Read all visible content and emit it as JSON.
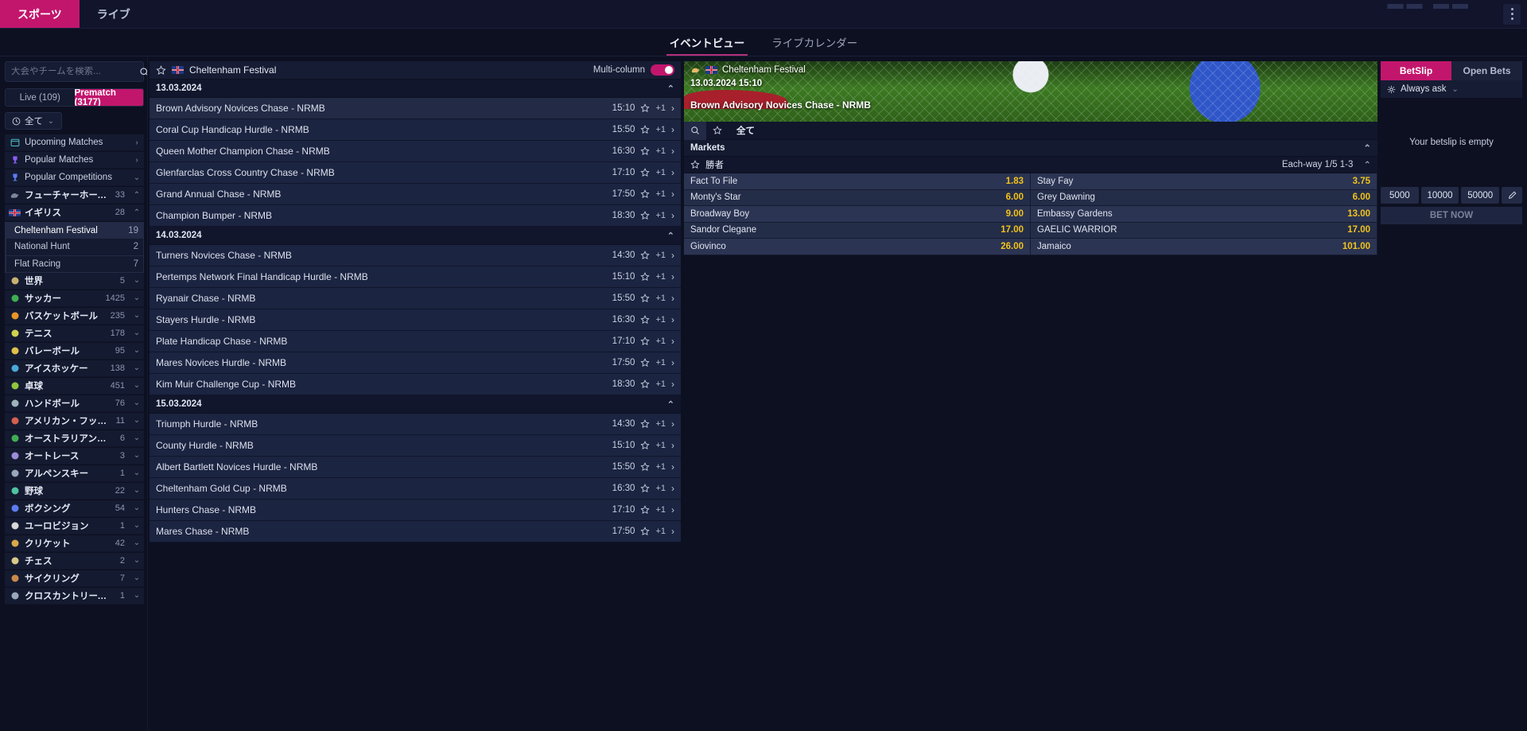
{
  "topbar": {
    "tabs": [
      {
        "label": "スポーツ",
        "active": true
      },
      {
        "label": "ライブ",
        "active": false
      }
    ],
    "menu_icon": "kebab-menu-icon"
  },
  "subnav": {
    "tabs": [
      {
        "label": "イベントビュー",
        "active": true
      },
      {
        "label": "ライブカレンダー",
        "active": false
      }
    ]
  },
  "sidebar": {
    "search": {
      "placeholder": "大会やチームを検索...",
      "value": "",
      "icon": "search-icon"
    },
    "segments": [
      {
        "label": "Live (109)",
        "active": false
      },
      {
        "label": "Prematch (3177)",
        "active": true
      }
    ],
    "time_filter": {
      "label": "全て",
      "icon": "clock-icon",
      "chevron": "⌄"
    },
    "nav_items": [
      {
        "label": "Upcoming Matches",
        "icon": "calendar-icon",
        "count": "",
        "chevron": "›"
      },
      {
        "label": "Popular Matches",
        "icon": "trophy-icon",
        "count": "",
        "chevron": "›"
      },
      {
        "label": "Popular Competitions",
        "icon": "trophy-icon",
        "count": "",
        "chevron": "⌄"
      }
    ],
    "groups": [
      {
        "label": "フューチャーホース...",
        "icon": "horse-racing-icon",
        "count": "33",
        "chevron": "⌃",
        "expanded": false,
        "children": []
      },
      {
        "label": "イギリス",
        "icon": "uk-flag-icon",
        "count": "28",
        "chevron": "⌃",
        "expanded": true,
        "children": [
          {
            "label": "Cheltenham Festival",
            "count": "19",
            "active": true
          },
          {
            "label": "National Hunt",
            "count": "2",
            "active": false
          },
          {
            "label": "Flat Racing",
            "count": "7",
            "active": false
          }
        ]
      }
    ],
    "sports": [
      {
        "label": "世界",
        "icon": "globe-icon",
        "count": "5",
        "chevron": "⌄"
      },
      {
        "label": "サッカー",
        "icon": "soccer-icon",
        "count": "1425",
        "chevron": "⌄"
      },
      {
        "label": "バスケットボール",
        "icon": "basketball-icon",
        "count": "235",
        "chevron": "⌄"
      },
      {
        "label": "テニス",
        "icon": "tennis-icon",
        "count": "178",
        "chevron": "⌄"
      },
      {
        "label": "バレーボール",
        "icon": "volleyball-icon",
        "count": "95",
        "chevron": "⌄"
      },
      {
        "label": "アイスホッケー",
        "icon": "ice-hockey-icon",
        "count": "138",
        "chevron": "⌄"
      },
      {
        "label": "卓球",
        "icon": "table-tennis-icon",
        "count": "451",
        "chevron": "⌄"
      },
      {
        "label": "ハンドボール",
        "icon": "handball-icon",
        "count": "76",
        "chevron": "⌄"
      },
      {
        "label": "アメリカン・フット...",
        "icon": "american-football-icon",
        "count": "11",
        "chevron": "⌄"
      },
      {
        "label": "オーストラリアン・…",
        "icon": "aussie-rules-icon",
        "count": "6",
        "chevron": "⌄"
      },
      {
        "label": "オートレース",
        "icon": "motor-racing-icon",
        "count": "3",
        "chevron": "⌄"
      },
      {
        "label": "アルペンスキー",
        "icon": "alpine-skiing-icon",
        "count": "1",
        "chevron": "⌄"
      },
      {
        "label": "野球",
        "icon": "baseball-icon",
        "count": "22",
        "chevron": "⌄"
      },
      {
        "label": "ボクシング",
        "icon": "boxing-icon",
        "count": "54",
        "chevron": "⌄"
      },
      {
        "label": "ユーロビジョン",
        "icon": "eurovision-icon",
        "count": "1",
        "chevron": "⌄"
      },
      {
        "label": "クリケット",
        "icon": "cricket-icon",
        "count": "42",
        "chevron": "⌄"
      },
      {
        "label": "チェス",
        "icon": "chess-icon",
        "count": "2",
        "chevron": "⌄"
      },
      {
        "label": "サイクリング",
        "icon": "cycling-icon",
        "count": "7",
        "chevron": "⌄"
      },
      {
        "label": "クロスカントリースキ...",
        "icon": "cross-country-skiing-icon",
        "count": "1",
        "chevron": "⌄"
      }
    ]
  },
  "events": {
    "header": {
      "title": "Cheltenham Festival",
      "star_icon": "star-icon",
      "flag": "uk-flag-icon",
      "multicolumn_label": "Multi-column",
      "multicolumn_on": true
    },
    "days": [
      {
        "date": "13.03.2024",
        "collapse_icon": "⌃",
        "rows": [
          {
            "name": "Brown Advisory Novices Chase - NRMB",
            "time": "15:10",
            "extra": "+1",
            "selected": true
          },
          {
            "name": "Coral Cup Handicap Hurdle - NRMB",
            "time": "15:50",
            "extra": "+1",
            "selected": false
          },
          {
            "name": "Queen Mother Champion Chase - NRMB",
            "time": "16:30",
            "extra": "+1",
            "selected": false
          },
          {
            "name": "Glenfarclas Cross Country Chase - NRMB",
            "time": "17:10",
            "extra": "+1",
            "selected": false
          },
          {
            "name": "Grand Annual Chase - NRMB",
            "time": "17:50",
            "extra": "+1",
            "selected": false
          },
          {
            "name": "Champion Bumper - NRMB",
            "time": "18:30",
            "extra": "+1",
            "selected": false
          }
        ]
      },
      {
        "date": "14.03.2024",
        "collapse_icon": "⌃",
        "rows": [
          {
            "name": "Turners Novices Chase - NRMB",
            "time": "14:30",
            "extra": "+1",
            "selected": false
          },
          {
            "name": "Pertemps Network Final Handicap Hurdle - NRMB",
            "time": "15:10",
            "extra": "+1",
            "selected": false
          },
          {
            "name": "Ryanair Chase - NRMB",
            "time": "15:50",
            "extra": "+1",
            "selected": false
          },
          {
            "name": "Stayers Hurdle - NRMB",
            "time": "16:30",
            "extra": "+1",
            "selected": false
          },
          {
            "name": "Plate Handicap Chase - NRMB",
            "time": "17:10",
            "extra": "+1",
            "selected": false
          },
          {
            "name": "Mares Novices Hurdle - NRMB",
            "time": "17:50",
            "extra": "+1",
            "selected": false
          },
          {
            "name": "Kim Muir Challenge Cup - NRMB",
            "time": "18:30",
            "extra": "+1",
            "selected": false
          }
        ]
      },
      {
        "date": "15.03.2024",
        "collapse_icon": "⌃",
        "rows": [
          {
            "name": "Triumph Hurdle - NRMB",
            "time": "14:30",
            "extra": "+1",
            "selected": false
          },
          {
            "name": "County Hurdle - NRMB",
            "time": "15:10",
            "extra": "+1",
            "selected": false
          },
          {
            "name": "Albert Bartlett Novices Hurdle - NRMB",
            "time": "15:50",
            "extra": "+1",
            "selected": false
          },
          {
            "name": "Cheltenham Gold Cup - NRMB",
            "time": "16:30",
            "extra": "+1",
            "selected": false
          },
          {
            "name": "Hunters Chase - NRMB",
            "time": "17:10",
            "extra": "+1",
            "selected": false
          },
          {
            "name": "Mares Chase - NRMB",
            "time": "17:50",
            "extra": "+1",
            "selected": false
          }
        ]
      }
    ]
  },
  "market": {
    "hero": {
      "competition": "Cheltenham Festival",
      "datetime": "13.03.2024 15:10",
      "event": "Brown Advisory Novices Chase - NRMB",
      "flag": "uk-flag-icon",
      "sport_icon": "horse-racing-icon"
    },
    "tools": {
      "search_icon": "search-icon",
      "star_icon": "star-icon",
      "all_label": "全て",
      "collapse_icon": "⌃"
    },
    "markets_label": "Markets",
    "market_title": "勝者",
    "each_way": "Each-way 1/5 1-3",
    "collapse_icon": "⌃",
    "star_icon": "star-icon",
    "odds": [
      {
        "name": "Fact To File",
        "value": "1.83"
      },
      {
        "name": "Stay Fay",
        "value": "3.75"
      },
      {
        "name": "Monty's Star",
        "value": "6.00"
      },
      {
        "name": "Grey Dawning",
        "value": "6.00"
      },
      {
        "name": "Broadway Boy",
        "value": "9.00"
      },
      {
        "name": "Embassy Gardens",
        "value": "13.00"
      },
      {
        "name": "Sandor Clegane",
        "value": "17.00"
      },
      {
        "name": "GAELIC WARRIOR",
        "value": "17.00"
      },
      {
        "name": "Giovinco",
        "value": "26.00"
      },
      {
        "name": "Jamaico",
        "value": "101.00"
      }
    ]
  },
  "betslip": {
    "tabs": [
      {
        "label": "BetSlip",
        "active": true
      },
      {
        "label": "Open Bets",
        "active": false
      }
    ],
    "always_ask": {
      "label": "Always ask",
      "icon": "gear-icon",
      "chevron": "⌄"
    },
    "empty_message": "Your betslip is empty",
    "stakes": [
      "5000",
      "10000",
      "50000"
    ],
    "edit_icon": "pencil-icon",
    "bet_now_label": "BET NOW"
  },
  "colors": {
    "accent": "#c2166d",
    "odds": "#f2c31c",
    "panel": "#141a30",
    "background": "#0d1021"
  }
}
